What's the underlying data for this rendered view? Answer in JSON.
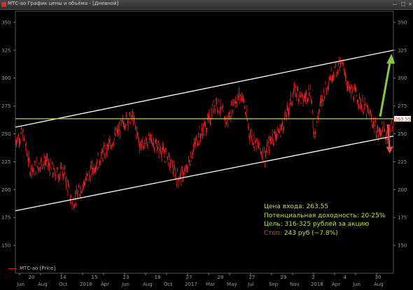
{
  "window": {
    "title": "МТС-ао График цены и объёма - [Дневной]"
  },
  "legend": {
    "label": "МТС-ао [Price]"
  },
  "annotation": {
    "entry": "Цена входа: 263.55",
    "yield": "Потенциальная доходность: 20-25%",
    "target": "Цель: 316-325 рублей за акцию",
    "stop_label": "Стоп:",
    "stop_value": " 243 руб (~7.8%)"
  },
  "colors": {
    "price": "#e02020",
    "channel": "#ffffff",
    "entry_line": "#b8e000",
    "up_arrow": "#8cc63f",
    "down_arrow": "#e05050"
  },
  "chart_data": {
    "type": "line",
    "series": [
      {
        "name": "МТС-ао [Price]"
      }
    ],
    "ylim": [
      125,
      360
    ],
    "y_ticks": [
      150,
      175,
      200,
      225,
      250,
      275,
      300,
      325,
      350
    ],
    "price_tag": "263.55",
    "x_ticks_top": [
      "20",
      "14",
      "15",
      "23",
      "18",
      "27",
      "28",
      "27",
      "29",
      "2",
      "4",
      "30"
    ],
    "x_ticks_bottom": [
      "Jun",
      "Aug",
      "Oct",
      "2016",
      "Apr",
      "Jun",
      "Aug",
      "Oct",
      "2017",
      "Mar",
      "May",
      "Jul",
      "Sep",
      "Nov",
      "2018",
      "Apr",
      "Jun",
      "Aug"
    ],
    "entry_level": 263.55,
    "stop_level": 243,
    "target_range": [
      316,
      325
    ],
    "upper_channel": [
      [
        0,
        256
      ],
      [
        1,
        325
      ]
    ],
    "lower_channel": [
      [
        0,
        181
      ],
      [
        1,
        248
      ]
    ],
    "keypoints": [
      [
        0.0,
        245
      ],
      [
        0.02,
        250
      ],
      [
        0.04,
        218
      ],
      [
        0.08,
        226
      ],
      [
        0.1,
        215
      ],
      [
        0.13,
        215
      ],
      [
        0.15,
        187
      ],
      [
        0.18,
        205
      ],
      [
        0.21,
        222
      ],
      [
        0.25,
        240
      ],
      [
        0.29,
        262
      ],
      [
        0.31,
        265
      ],
      [
        0.33,
        240
      ],
      [
        0.36,
        244
      ],
      [
        0.4,
        230
      ],
      [
        0.43,
        210
      ],
      [
        0.45,
        215
      ],
      [
        0.48,
        245
      ],
      [
        0.51,
        260
      ],
      [
        0.53,
        280
      ],
      [
        0.56,
        260
      ],
      [
        0.58,
        280
      ],
      [
        0.6,
        285
      ],
      [
        0.62,
        250
      ],
      [
        0.64,
        240
      ],
      [
        0.66,
        230
      ],
      [
        0.68,
        248
      ],
      [
        0.7,
        252
      ],
      [
        0.72,
        270
      ],
      [
        0.74,
        290
      ],
      [
        0.76,
        280
      ],
      [
        0.78,
        290
      ],
      [
        0.79,
        250
      ],
      [
        0.81,
        280
      ],
      [
        0.83,
        300
      ],
      [
        0.85,
        310
      ],
      [
        0.87,
        310
      ],
      [
        0.88,
        290
      ],
      [
        0.9,
        285
      ],
      [
        0.92,
        275
      ],
      [
        0.94,
        265
      ],
      [
        0.96,
        250
      ],
      [
        0.97,
        255
      ],
      [
        0.98,
        248
      ],
      [
        1.0,
        260
      ]
    ]
  }
}
